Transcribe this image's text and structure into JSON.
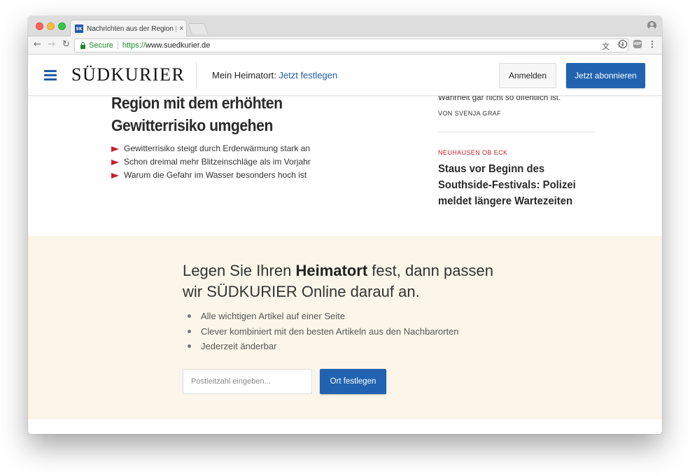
{
  "browser": {
    "tab_title": "Nachrichten aus der Region | S",
    "tab_close": "×",
    "favicon_text": "SK",
    "secure_label": "Secure",
    "url_scheme": "https://",
    "url_host": "www.suedkurier.de"
  },
  "site": {
    "logo": "SÜDKURIER",
    "heimatort_label": "Mein Heimatort:",
    "heimatort_link": "Jetzt festlegen",
    "login_label": "Anmelden",
    "subscribe_label": "Jetzt abonnieren",
    "brand_color": "#2163b0",
    "accent_color": "#c8202b"
  },
  "main_article": {
    "headline_line1": "Region mit dem erhöhten",
    "headline_line2": "Gewitterrisiko umgehen",
    "bullets": [
      "Gewitterrisiko steigt durch Erderwärmung stark an",
      "Schon dreimal mehr Blitzeinschläge als im Vorjahr",
      "Warum die Gefahr im Wasser besonders hoch ist"
    ]
  },
  "side_articles": {
    "teaser_text": "Wahrheit gar nicht so öffentlich ist.",
    "author": "VON SVENJA GRAF",
    "kicker": "NEUHAUSEN OB ECK",
    "headline": "Staus vor Beginn des Southside-Festivals: Polizei meldet längere Wartezeiten"
  },
  "promo": {
    "title_part1": "Legen Sie Ihren ",
    "title_bold": "Heimatort",
    "title_part2": " fest, dann passen wir SÜDKURIER Online darauf an.",
    "items": [
      "Alle wichtigen Artikel auf einer Seite",
      "Clever kombiniert mit den besten Artikeln aus den Nachbarorten",
      "Jederzeit änderbar"
    ],
    "input_placeholder": "Postleitzahl eingeben...",
    "button_label": "Ort festlegen",
    "background_color": "#fcf6ea"
  },
  "icons": {
    "back": "←",
    "forward": "→",
    "reload": "↻",
    "translate": "文",
    "star": "☆",
    "info": "i",
    "abp": "ABP",
    "menu": "⋮"
  }
}
